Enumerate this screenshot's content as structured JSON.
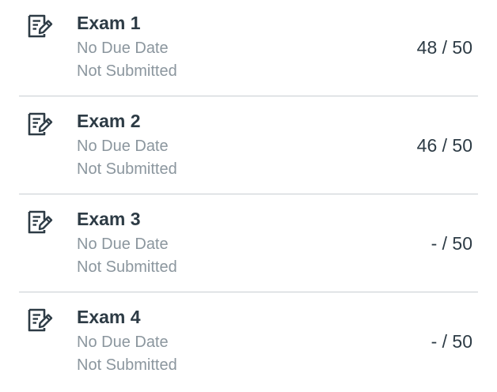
{
  "assignments": [
    {
      "title": "Exam 1",
      "due": "No Due Date",
      "status": "Not Submitted",
      "score": "48 / 50",
      "icon": "quiz-icon"
    },
    {
      "title": "Exam 2",
      "due": "No Due Date",
      "status": "Not Submitted",
      "score": "46 / 50",
      "icon": "quiz-icon"
    },
    {
      "title": "Exam 3",
      "due": "No Due Date",
      "status": "Not Submitted",
      "score": "- / 50",
      "icon": "quiz-icon"
    },
    {
      "title": "Exam 4",
      "due": "No Due Date",
      "status": "Not Submitted",
      "score": "- / 50",
      "icon": "quiz-icon"
    }
  ],
  "colors": {
    "title": "#2d3b45",
    "secondary": "#8b969e",
    "divider": "#c7cdd1"
  }
}
